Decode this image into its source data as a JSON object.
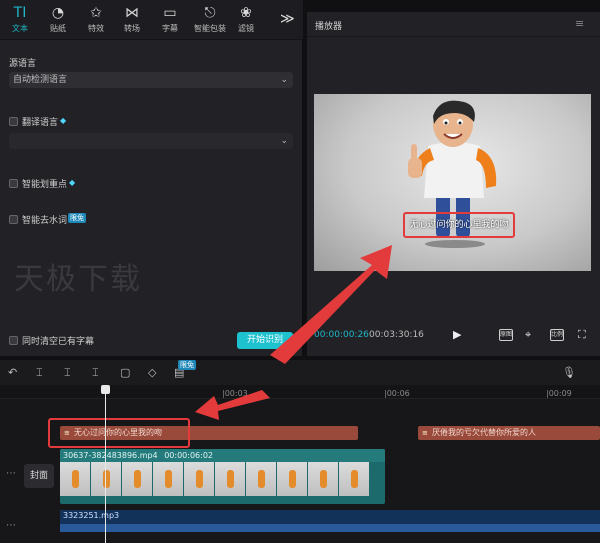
{
  "toolbar": {
    "items": [
      {
        "icon": "TI",
        "label": "文本"
      },
      {
        "icon": "◔",
        "label": "贴纸"
      },
      {
        "icon": "✩",
        "label": "特效"
      },
      {
        "icon": "⋈",
        "label": "转场"
      },
      {
        "icon": "▭",
        "label": "字幕"
      },
      {
        "icon": "⎋",
        "label": "智能包装"
      },
      {
        "icon": "❀",
        "label": "滤镜"
      }
    ],
    "more": "≫"
  },
  "left": {
    "source_language_label": "源语言",
    "source_language_value": "自动检测语言",
    "translate_label": "翻译语言",
    "smart_emphasis_label": "智能划重点",
    "smart_filler_label": "智能去水词",
    "free_badge": "限免",
    "watermark": "天极下载",
    "clear_existing_label": "同时清空已有字幕",
    "start_button": "开始识别",
    "chev": "⌄"
  },
  "player": {
    "title": "播放器",
    "subtitle": "无心过问你的心里我的吻",
    "current_time": "00:00:00:26",
    "total_time": "00:03:30:16",
    "play_icon": "▶",
    "btn_quality": "原图",
    "btn_ratio": "比例"
  },
  "timeline": {
    "ticks": [
      "|00:03",
      "|00:06",
      "|00:09"
    ],
    "free_badge": "限免",
    "subtitle_clips": [
      "无心过问你的心里我的吻",
      "厌倦我的亏欠代替你所爱的人"
    ],
    "clip_icon": "≡",
    "video_clip_name": "30637-382483896.mp4",
    "video_clip_duration": "00:00:06:02",
    "cover_label": "封面",
    "audio_clip_name": "3323251.mp3"
  },
  "colors": {
    "accent": "#1fb6c7",
    "subtitle_clip": "#9a4a3a",
    "video_clip": "#1c6a6b",
    "audio_clip": "#12325a",
    "annotation": "#e33b3b"
  }
}
